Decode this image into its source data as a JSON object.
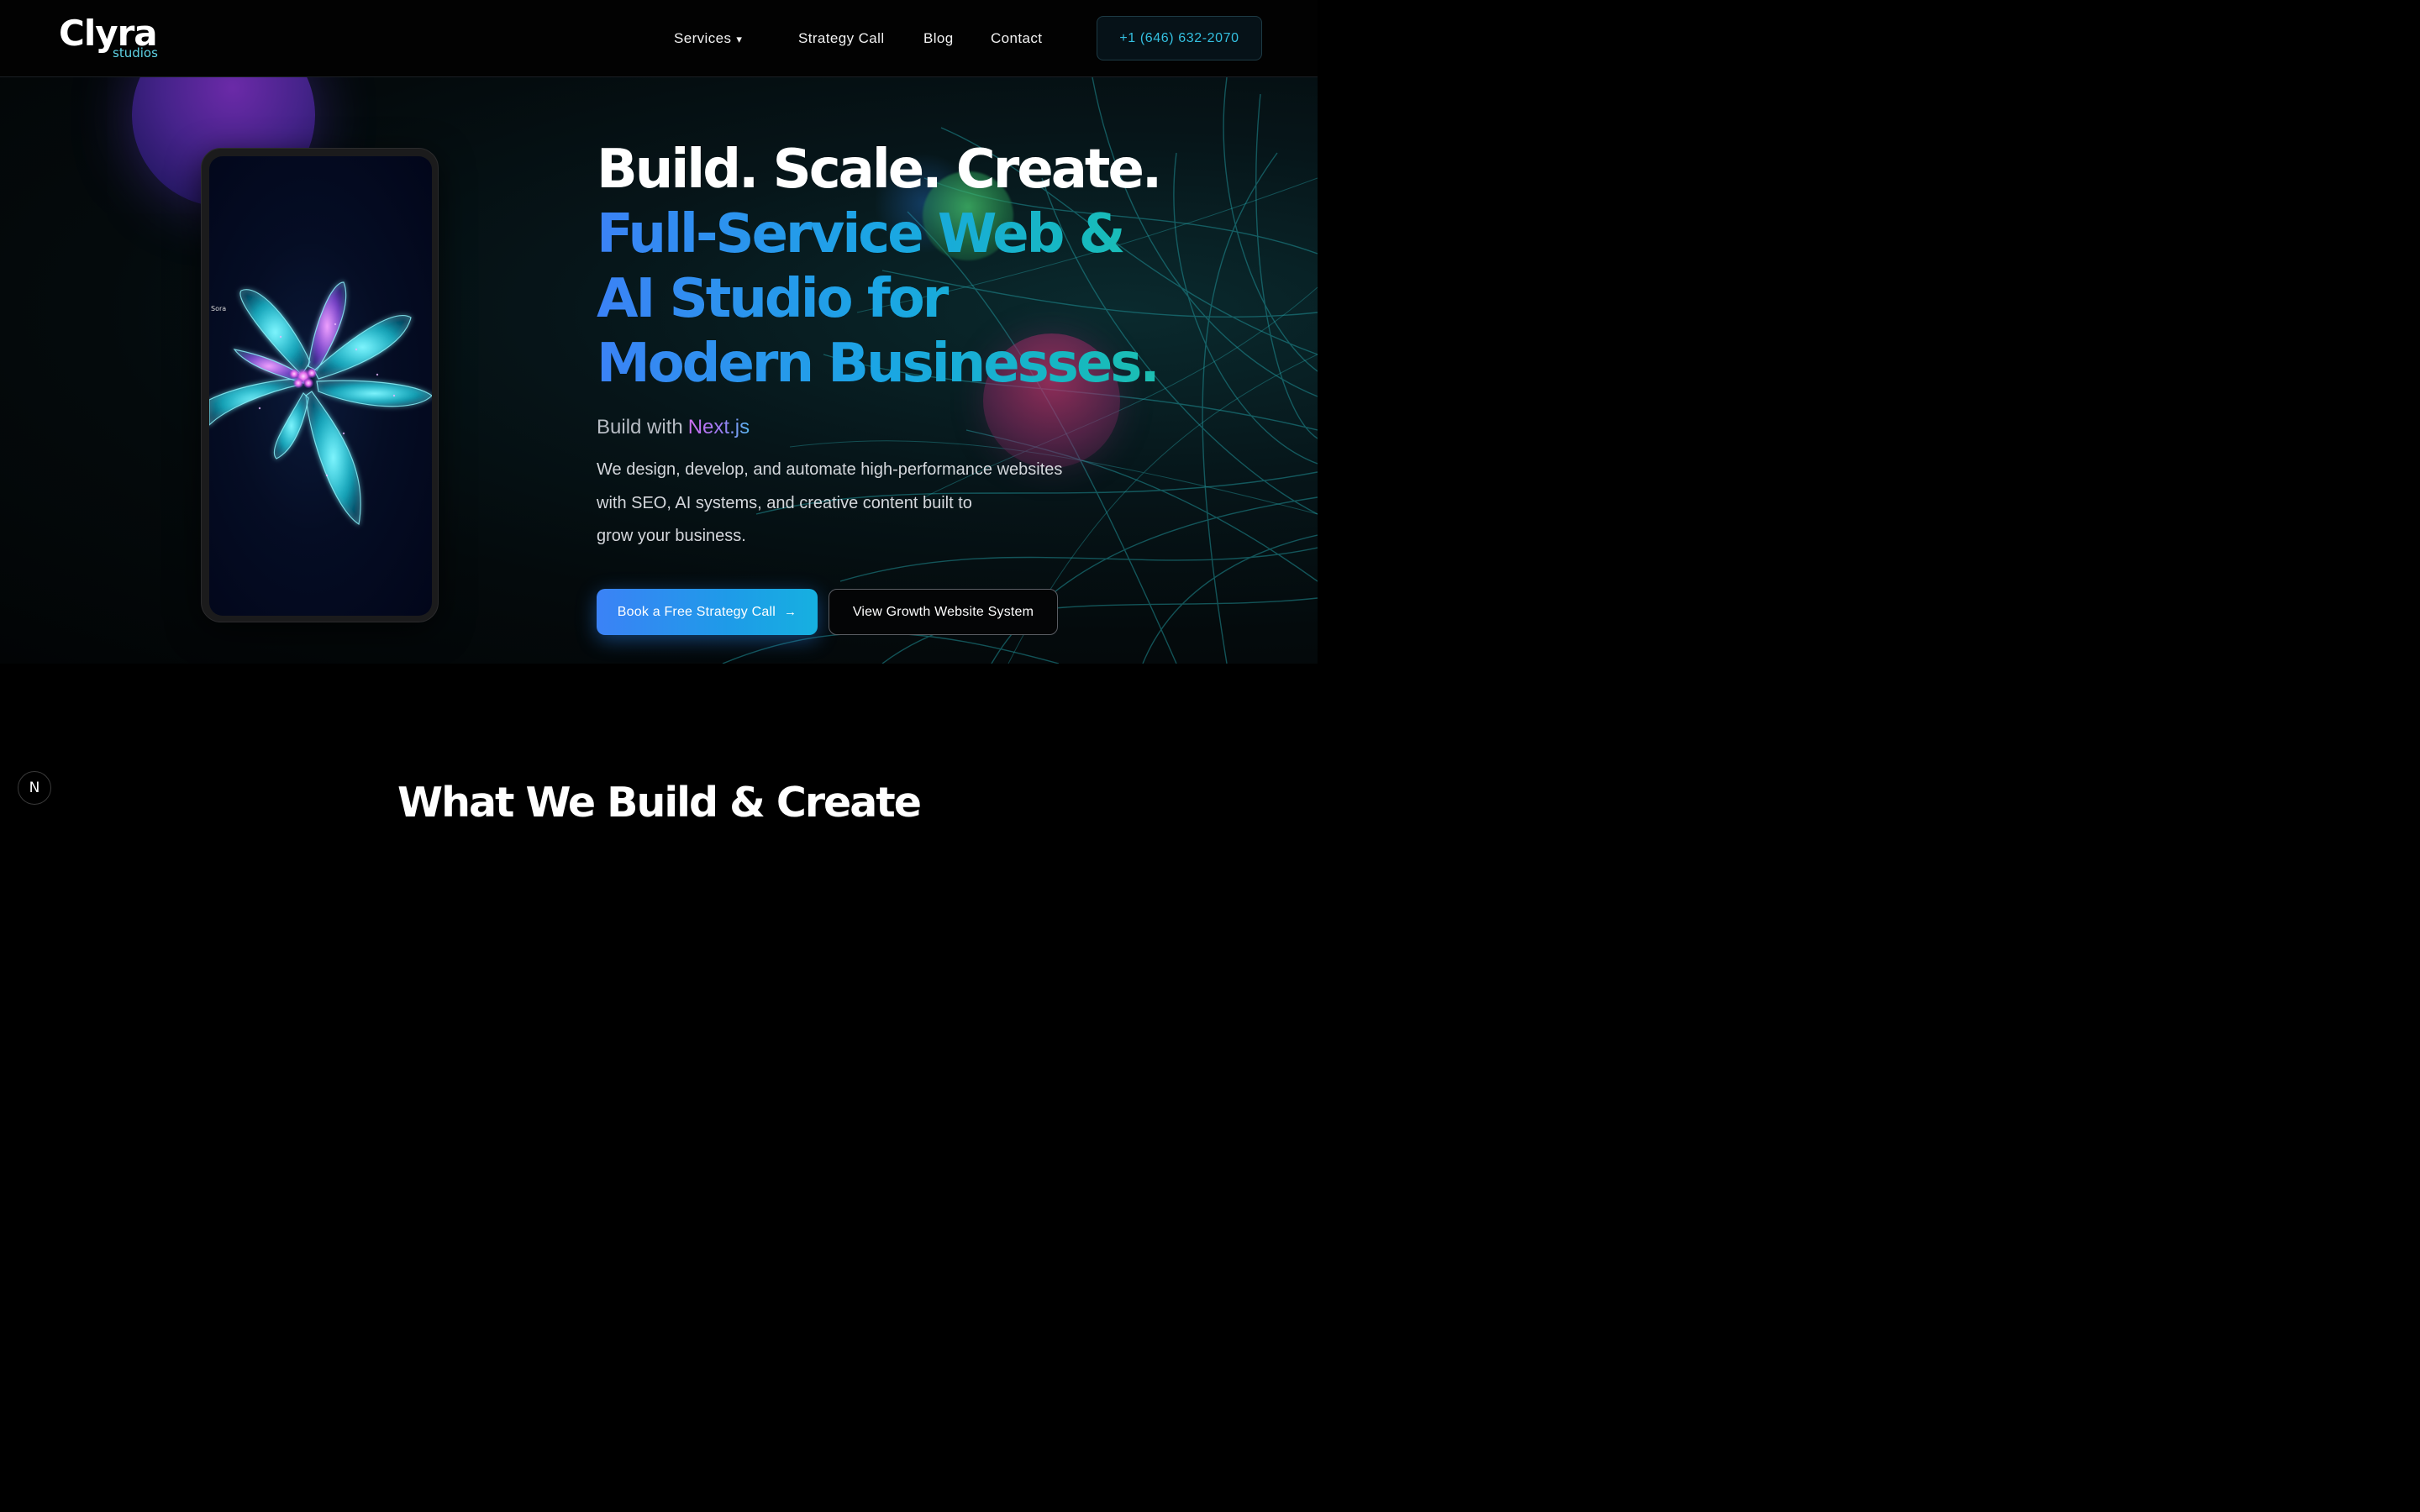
{
  "header": {
    "logo_main": "Clyra",
    "logo_sub": "studios",
    "nav": [
      {
        "label": "Services",
        "caret": "▾"
      },
      {
        "label": "Strategy Call"
      },
      {
        "label": "Blog"
      },
      {
        "label": "Contact"
      }
    ],
    "phone": "+1 (646) 632-2070"
  },
  "hero": {
    "device_caption": "Sora",
    "headline_white": "Build. Scale. Create.",
    "headline_gradient": [
      "Full-Service Web &",
      "AI Studio for",
      "Modern Businesses."
    ],
    "build_with_label": "Build with",
    "build_with_tech": "Next.js",
    "description": [
      "We design, develop, and automate high-performance websites",
      "with SEO, AI systems, and creative content built to",
      "grow your business."
    ],
    "cta_primary": "Book a Free Strategy Call",
    "cta_primary_icon": "→",
    "cta_secondary": "View Growth Website System"
  },
  "section": {
    "title": "What We Build & Create"
  },
  "badge": {
    "label": "N"
  },
  "colors": {
    "accent_blue": "#3b82f6",
    "accent_teal": "#16b8c0",
    "phone_text": "#34c0e0"
  }
}
